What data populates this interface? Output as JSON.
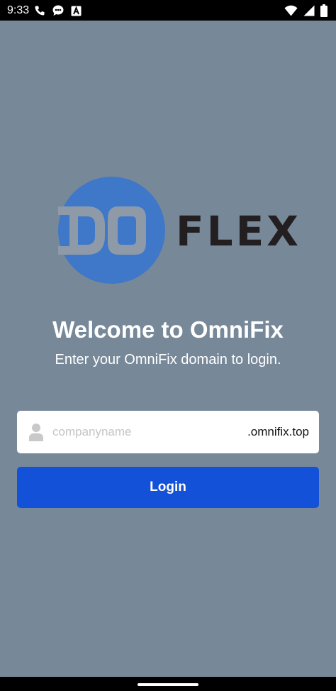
{
  "status_bar": {
    "time": "9:33",
    "left_icons": [
      "phone-icon",
      "chat-bubble-icon",
      "a-box-icon"
    ],
    "right_icons": [
      "wifi-icon",
      "signal-icon",
      "battery-icon"
    ]
  },
  "logo": {
    "mark_text": "DO",
    "word": "FLEX",
    "circle_color": "#3f78c8"
  },
  "welcome": {
    "title": "Welcome to OmniFix",
    "subtitle": "Enter your OmniFix domain to login."
  },
  "domain_field": {
    "placeholder": "companyname",
    "value": "",
    "suffix": ".omnifix.top",
    "icon": "user-icon"
  },
  "login_button": {
    "label": "Login",
    "color": "#1351d8"
  },
  "colors": {
    "background": "#778899",
    "accent": "#1351d8"
  }
}
